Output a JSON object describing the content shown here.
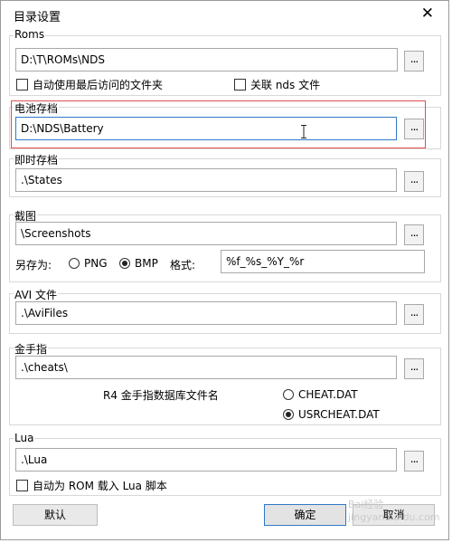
{
  "window": {
    "title": "目录设置",
    "close_glyph": "✕"
  },
  "roms": {
    "label": "Roms",
    "path": "D:\\T\\ROMs\\NDS",
    "browse_label": "...",
    "auto_last_visited": "自动使用最后访问的文件夹",
    "associate_nds": "关联 nds 文件"
  },
  "battery": {
    "label": "电池存档",
    "path": "D:\\NDS\\Battery",
    "browse_label": "..."
  },
  "states": {
    "label": "即时存档",
    "path": ".\\States",
    "browse_label": "..."
  },
  "screenshots": {
    "label": "截图",
    "path": "\\Screenshots",
    "browse_label": "...",
    "save_as_label": "另存为:",
    "png_label": "PNG",
    "bmp_label": "BMP",
    "selected_format": "BMP",
    "format_label": "格式:",
    "format_value": "%f_%s_%Y_%r"
  },
  "avi": {
    "label": "AVI 文件",
    "path": ".\\AviFiles",
    "browse_label": "..."
  },
  "cheats": {
    "label": "金手指",
    "path": ".\\cheats\\",
    "browse_label": "...",
    "r4_db_label": "R4 金手指数据库文件名",
    "option_cheat": "CHEAT.DAT",
    "option_usrcheat": "USRCHEAT.DAT",
    "selected_db": "USRCHEAT.DAT"
  },
  "lua": {
    "label": "Lua",
    "path": ".\\Lua",
    "browse_label": "...",
    "auto_load_lua": "自动为 ROM 载入 Lua 脚本"
  },
  "buttons": {
    "default": "默认",
    "ok": "确定",
    "cancel": "取消"
  },
  "watermark": "Bai经验 jingyan.baidu.com"
}
